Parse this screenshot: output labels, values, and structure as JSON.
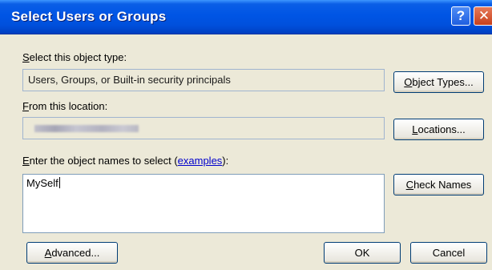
{
  "window": {
    "title": "Select Users or Groups",
    "help_glyph": "?",
    "close_glyph": "✕"
  },
  "object_type": {
    "label_key": "S",
    "label_rest": "elect this object type:",
    "value": "Users, Groups, or Built-in security principals",
    "button_key": "O",
    "button_rest": "bject Types..."
  },
  "location": {
    "label_key": "F",
    "label_rest": "rom this location:",
    "value_obscured": true,
    "button_key": "L",
    "button_rest": "ocations..."
  },
  "names": {
    "label_key": "E",
    "label_pre": "nter the object names to select (",
    "link_text": "examples",
    "label_post": "):",
    "value": "MySelf",
    "check_key": "C",
    "check_rest": "heck Names"
  },
  "footer": {
    "advanced_key": "A",
    "advanced_rest": "dvanced...",
    "ok_label": "OK",
    "cancel_label": "Cancel"
  },
  "colors": {
    "title_bar": "#0055e5",
    "dialog_bg": "#ece9d8",
    "button_border": "#003c74",
    "link": "#0000cc"
  }
}
